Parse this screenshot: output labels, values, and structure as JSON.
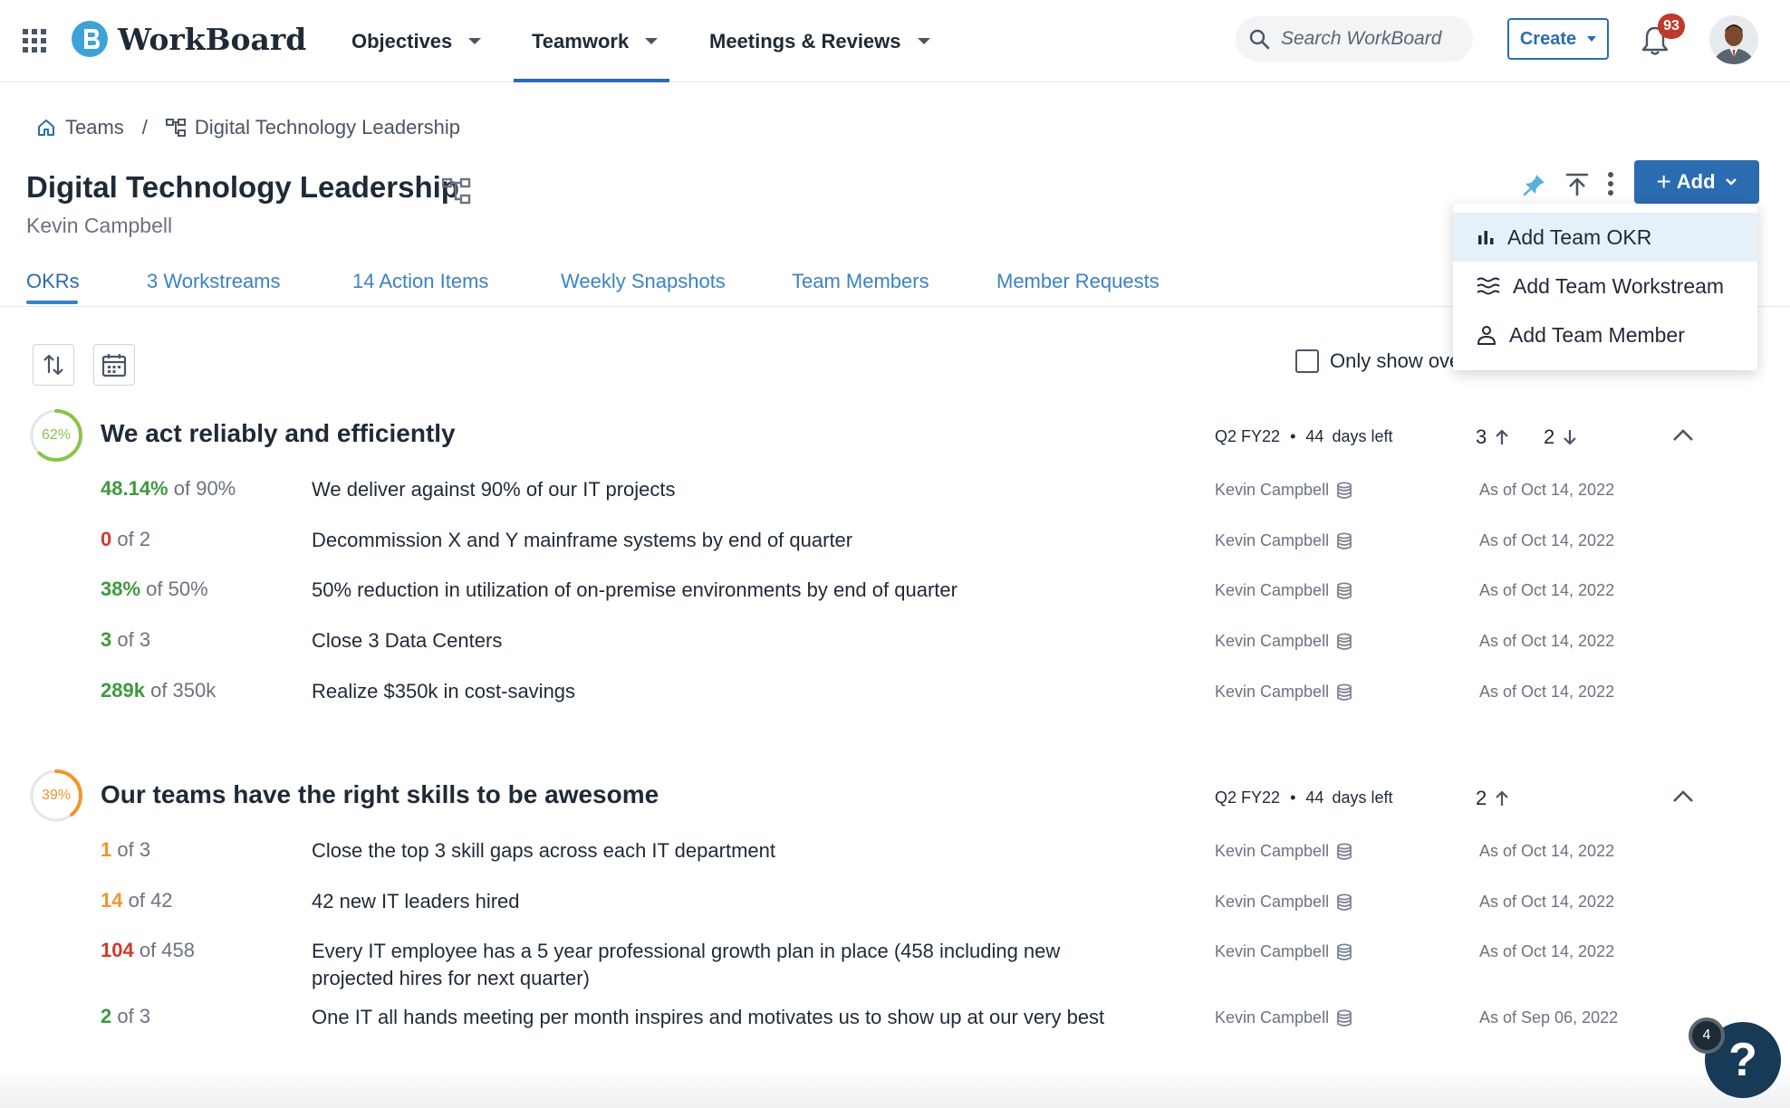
{
  "app": {
    "name": "WorkBoard"
  },
  "nav": {
    "items": [
      {
        "label": "Objectives"
      },
      {
        "label": "Teamwork"
      },
      {
        "label": "Meetings & Reviews"
      }
    ],
    "active": "Teamwork"
  },
  "search": {
    "placeholder": "Search WorkBoard"
  },
  "toolbar": {
    "create_label": "Create",
    "notifications_count": "93",
    "add_label": "Add"
  },
  "breadcrumb": {
    "home": "Teams",
    "separator": "/",
    "current": "Digital Technology Leadership"
  },
  "page": {
    "title": "Digital Technology Leadership",
    "owner": "Kevin Campbell"
  },
  "tabs": [
    {
      "label": "OKRs"
    },
    {
      "label": "3 Workstreams"
    },
    {
      "label": "14 Action Items"
    },
    {
      "label": "Weekly Snapshots"
    },
    {
      "label": "Team Members"
    },
    {
      "label": "Member Requests"
    }
  ],
  "add_menu": [
    {
      "label": "Add Team OKR",
      "icon": "bar-chart-icon"
    },
    {
      "label": "Add Team Workstream",
      "icon": "workstream-icon"
    },
    {
      "label": "Add Team Member",
      "icon": "person-icon"
    }
  ],
  "filter": {
    "only_show_label": "Only show ove"
  },
  "objectives": [
    {
      "percent": "62%",
      "percent_value": 0.62,
      "color": "#8bc34a",
      "title": "We act reliably and efficiently",
      "period": "Q2 FY22",
      "days_left": "44",
      "days_left_label": "days left",
      "up_count": "3",
      "down_count": "2",
      "key_results": [
        {
          "score": "48.14%",
          "target": "of 90%",
          "score_color": "#3d9a3d",
          "name": "We deliver against 90% of our IT projects",
          "owner": "Kevin Campbell",
          "date": "As of Oct 14, 2022"
        },
        {
          "score": "0",
          "target": "of 2",
          "score_color": "#d0392b",
          "name": "Decommission X and Y mainframe systems by end of quarter",
          "owner": "Kevin Campbell",
          "date": "As of Oct 14, 2022"
        },
        {
          "score": "38%",
          "target": "of 50%",
          "score_color": "#3d9a3d",
          "name": "50% reduction in utilization of on-premise environments by end of quarter",
          "owner": "Kevin Campbell",
          "date": "As of Oct 14, 2022"
        },
        {
          "score": "3",
          "target": "of 3",
          "score_color": "#3d9a3d",
          "name": "Close 3 Data Centers",
          "owner": "Kevin Campbell",
          "date": "As of Oct 14, 2022"
        },
        {
          "score": "289k",
          "target": "of 350k",
          "score_color": "#3d9a3d",
          "name": "Realize $350k in cost-savings",
          "owner": "Kevin Campbell",
          "date": "As of Oct 14, 2022"
        }
      ]
    },
    {
      "percent": "39%",
      "percent_value": 0.39,
      "color": "#f0952b",
      "title": "Our teams have the right skills to be awesome",
      "period": "Q2 FY22",
      "days_left": "44",
      "days_left_label": "days left",
      "up_count": "2",
      "key_results": [
        {
          "score": "1",
          "target": "of 3",
          "score_color": "#f0952b",
          "name": "Close the top 3 skill gaps across each IT department",
          "owner": "Kevin Campbell",
          "date": "As of Oct 14, 2022"
        },
        {
          "score": "14",
          "target": "of 42",
          "score_color": "#f0952b",
          "name": "42 new IT leaders hired",
          "owner": "Kevin Campbell",
          "date": "As of Oct 14, 2022"
        },
        {
          "score": "104",
          "target": "of 458",
          "score_color": "#d0392b",
          "name": "Every IT employee has a 5 year professional growth plan in place (458 including new projected hires for next quarter)",
          "owner": "Kevin Campbell",
          "date": "As of Oct 14, 2022"
        },
        {
          "score": "2",
          "target": "of 3",
          "score_color": "#3d9a3d",
          "name": "One IT all hands meeting per month inspires and motivates us to show up at our very best",
          "owner": "Kevin Campbell",
          "date": "As of Sep 06, 2022"
        }
      ]
    }
  ],
  "help": {
    "label": "?",
    "count": "4"
  }
}
